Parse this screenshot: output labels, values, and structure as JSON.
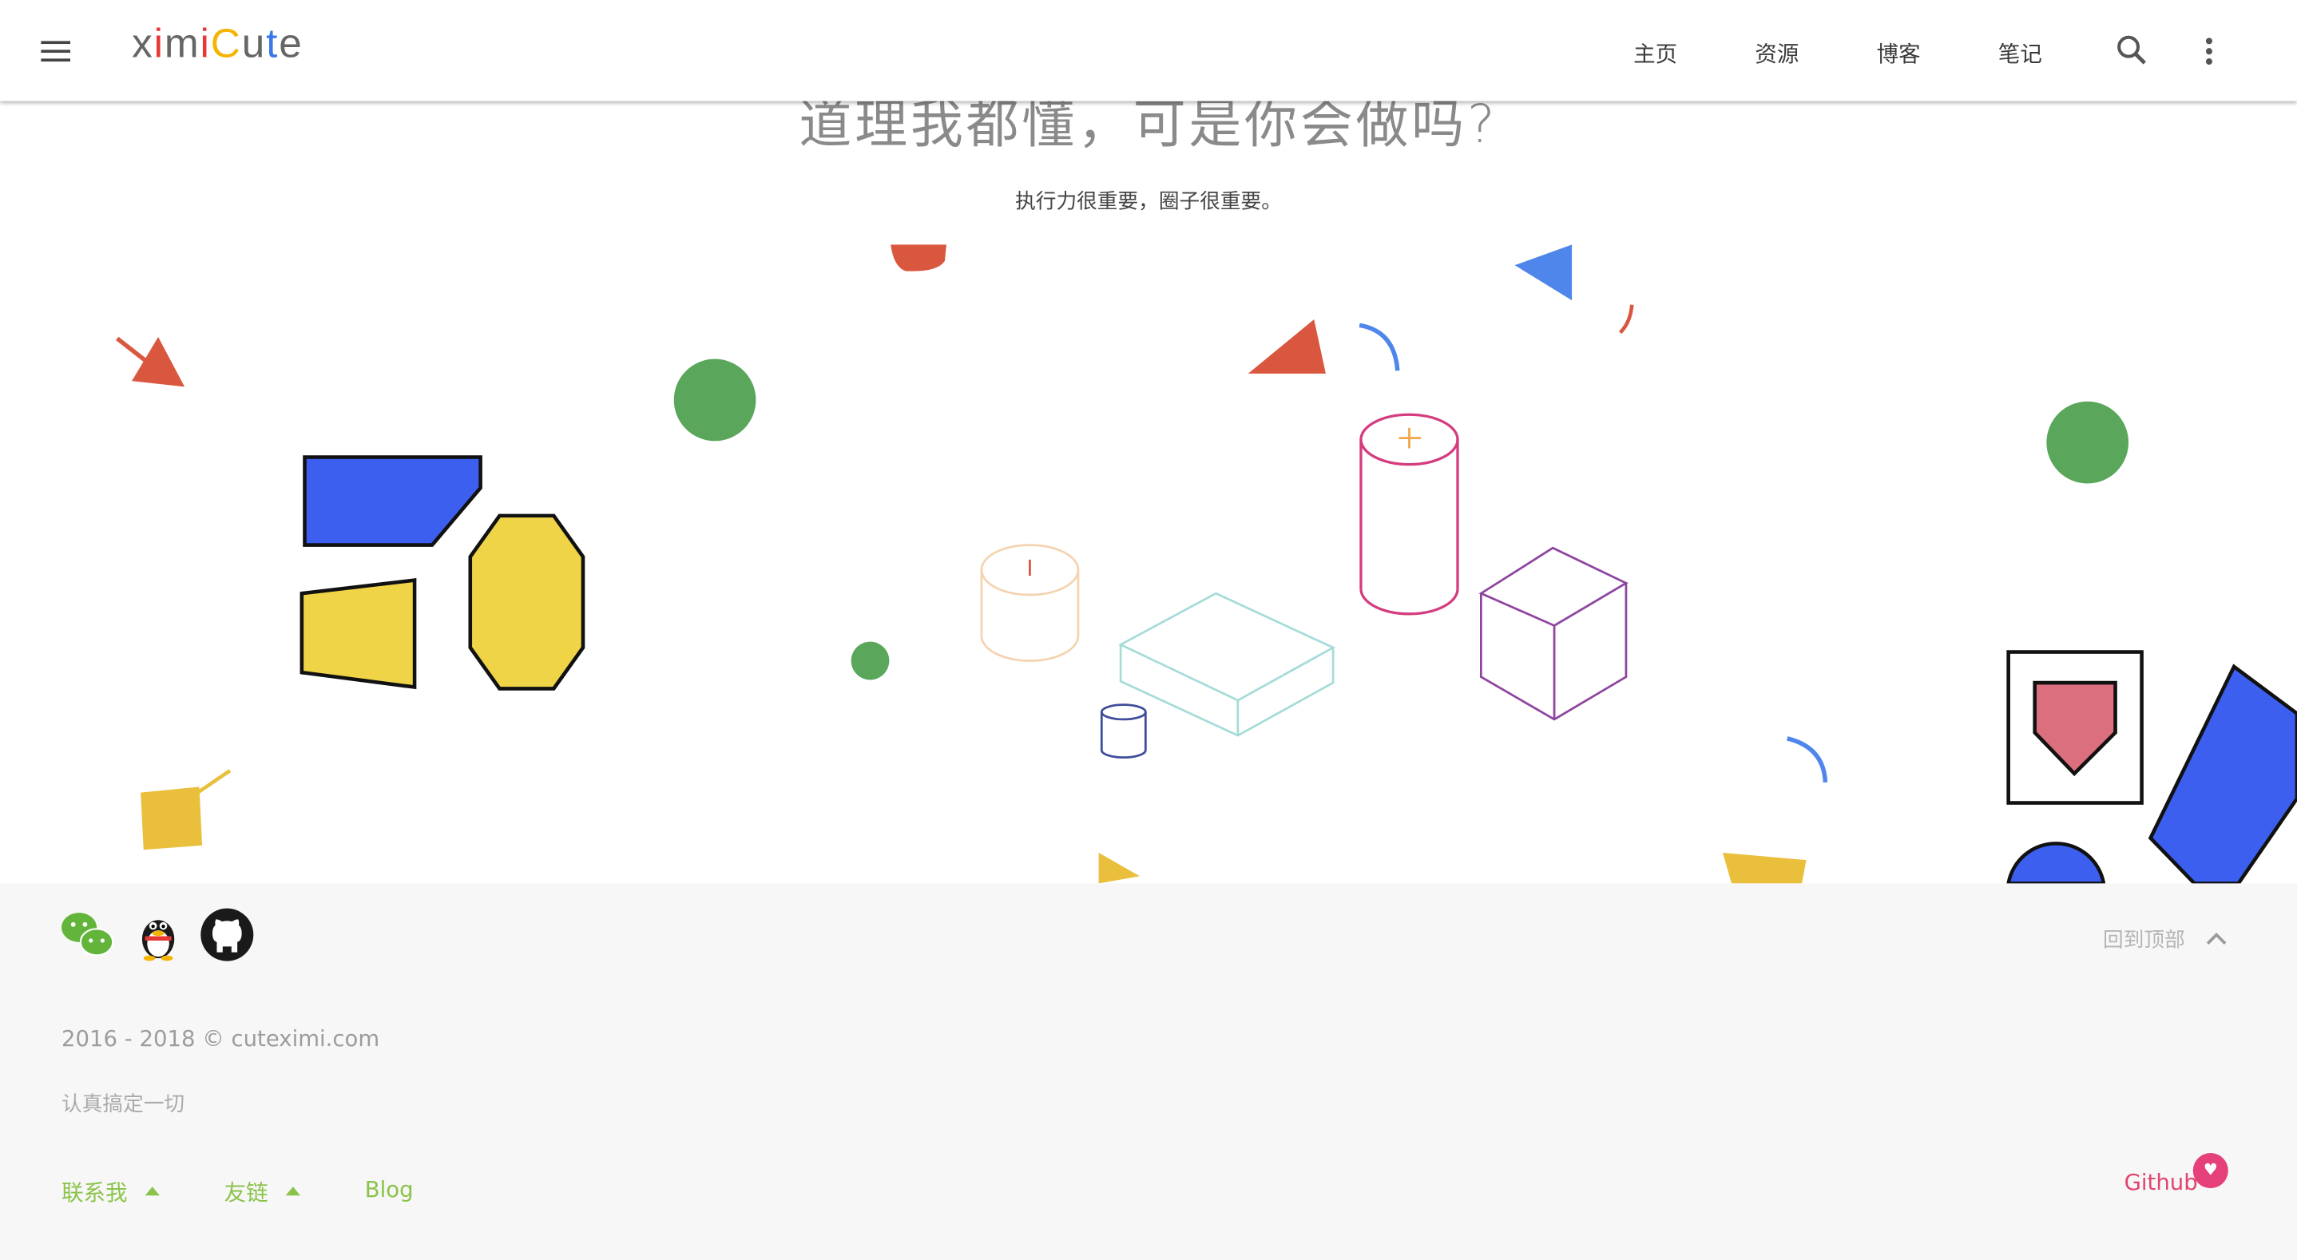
{
  "header": {
    "logo_letters": [
      "x",
      "i",
      "m",
      "i",
      "C",
      "u",
      "t",
      "e"
    ],
    "logo_colors": [
      "#666666",
      "#e53935",
      "#666666",
      "#e53935",
      "#f4b400",
      "#666666",
      "#3b78e7",
      "#666666"
    ],
    "nav": [
      "主页",
      "资源",
      "博客",
      "笔记"
    ]
  },
  "hero": {
    "title": "道理我都懂，可是你会做吗?",
    "subtitle": "执行力很重要，圈子很重要。"
  },
  "footer": {
    "social": [
      "wechat-icon",
      "qq-icon",
      "github-icon"
    ],
    "back_to_top": "回到顶部",
    "copyright": "2016 - 2018 © cuteximi.com",
    "motto": "认真搞定一切",
    "links": [
      "联系我",
      "友链",
      "Blog"
    ],
    "github": "Github",
    "heart": "♥"
  },
  "colors": {
    "red": "#d9573f",
    "green": "#5aa75c",
    "blue": "#3d5ff0",
    "yellow": "#f0d447",
    "link_green": "#8bc34a",
    "pink": "#e0456e"
  }
}
